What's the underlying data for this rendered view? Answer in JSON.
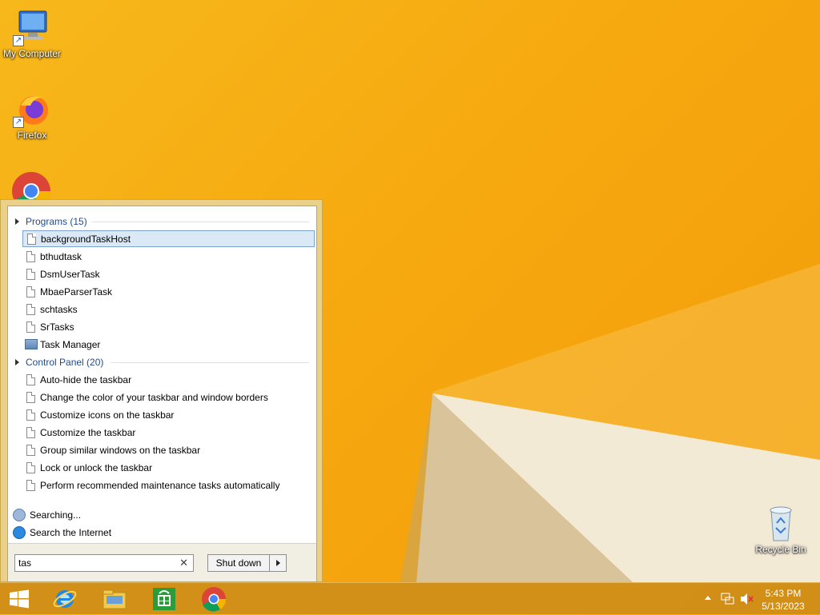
{
  "desktop": {
    "icons": [
      {
        "label": "My Computer"
      },
      {
        "label": "Firefox"
      },
      {
        "label": "Recycle Bin"
      }
    ]
  },
  "start_menu": {
    "groups": [
      {
        "label": "Programs (15)"
      },
      {
        "label": "Control Panel (20)"
      }
    ],
    "programs": [
      "backgroundTaskHost",
      "bthudtask",
      "DsmUserTask",
      "MbaeParserTask",
      "schtasks",
      "SrTasks",
      "Task Manager"
    ],
    "control_panel": [
      "Auto-hide the taskbar",
      "Change the color of your taskbar and window borders",
      "Customize icons on the taskbar",
      "Customize the taskbar",
      "Group similar windows on the taskbar",
      "Lock or unlock the taskbar",
      "Perform recommended maintenance tasks automatically"
    ],
    "searching_label": "Searching...",
    "search_internet_label": "Search the Internet",
    "search_value": "tas",
    "shutdown_label": "Shut down"
  },
  "taskbar": {
    "time": "5:43 PM",
    "date": "5/13/2023"
  },
  "colors": {
    "wallpaper": "#f6a90f",
    "taskbar": "#ce8e1a",
    "selection": "#dbe9f7"
  }
}
